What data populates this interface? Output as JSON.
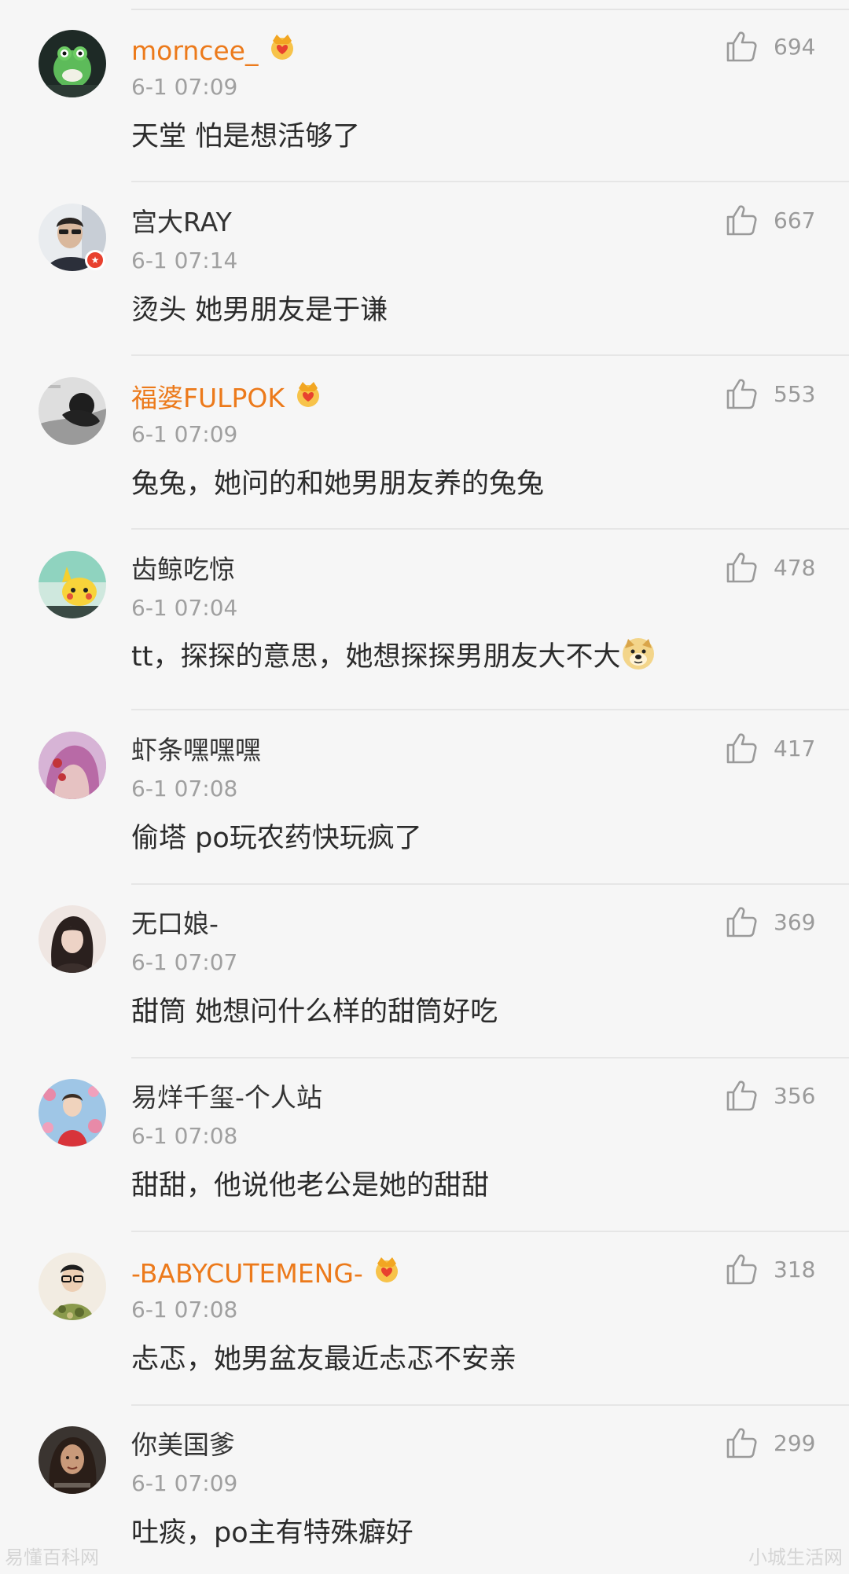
{
  "comments": [
    {
      "username": "morncee_",
      "vip": true,
      "timestamp": "6-1 07:09",
      "text": "天堂 怕是想活够了",
      "likes": "694",
      "avatar": "frog-avatar"
    },
    {
      "username": "宫大RAY",
      "vip": false,
      "verified": true,
      "timestamp": "6-1 07:14",
      "text": "烫头 她男朋友是于谦",
      "likes": "667",
      "avatar": "man-sunglasses-avatar"
    },
    {
      "username": "福婆FULPOK",
      "vip": true,
      "timestamp": "6-1 07:09",
      "text": "兔兔，她问的和她男朋友养的兔兔",
      "likes": "553",
      "avatar": "grayscale-photo-avatar"
    },
    {
      "username": "齿鲸吃惊",
      "vip": false,
      "timestamp": "6-1 07:04",
      "text": "tt，探探的意思，她想探探男朋友大不大",
      "emoji": "doge-emoji",
      "likes": "478",
      "avatar": "pikachu-avatar"
    },
    {
      "username": "虾条嘿嘿嘿",
      "vip": false,
      "timestamp": "6-1 07:08",
      "text": "偷塔 po玩农药快玩疯了",
      "likes": "417",
      "avatar": "pink-hair-avatar"
    },
    {
      "username": "无口娘-",
      "vip": false,
      "timestamp": "6-1 07:07",
      "text": "甜筒 她想问什么样的甜筒好吃",
      "likes": "369",
      "avatar": "girl-avatar"
    },
    {
      "username": "易烊千玺-个人站",
      "vip": false,
      "timestamp": "6-1 07:08",
      "text": "甜甜，他说他老公是她的甜甜",
      "likes": "356",
      "avatar": "boy-flowers-avatar"
    },
    {
      "username": "-BABYCUTEMENG-",
      "vip": true,
      "timestamp": "6-1 07:08",
      "text": "忐忑，她男盆友最近忐忑不安亲",
      "likes": "318",
      "avatar": "glasses-camo-avatar"
    },
    {
      "username": "你美国爹",
      "vip": false,
      "timestamp": "6-1 07:09",
      "text": "吐痰，po主有特殊癖好",
      "likes": "299",
      "avatar": "woman-portrait-avatar"
    }
  ],
  "watermarks": {
    "left": "易懂百科网",
    "right": "小城生活网"
  },
  "colors": {
    "vip_name": "#ec7a1b",
    "normal_name": "#333333",
    "timestamp": "#a0a0a0",
    "like": "#9a9a9a",
    "background": "#f6f6f6"
  }
}
